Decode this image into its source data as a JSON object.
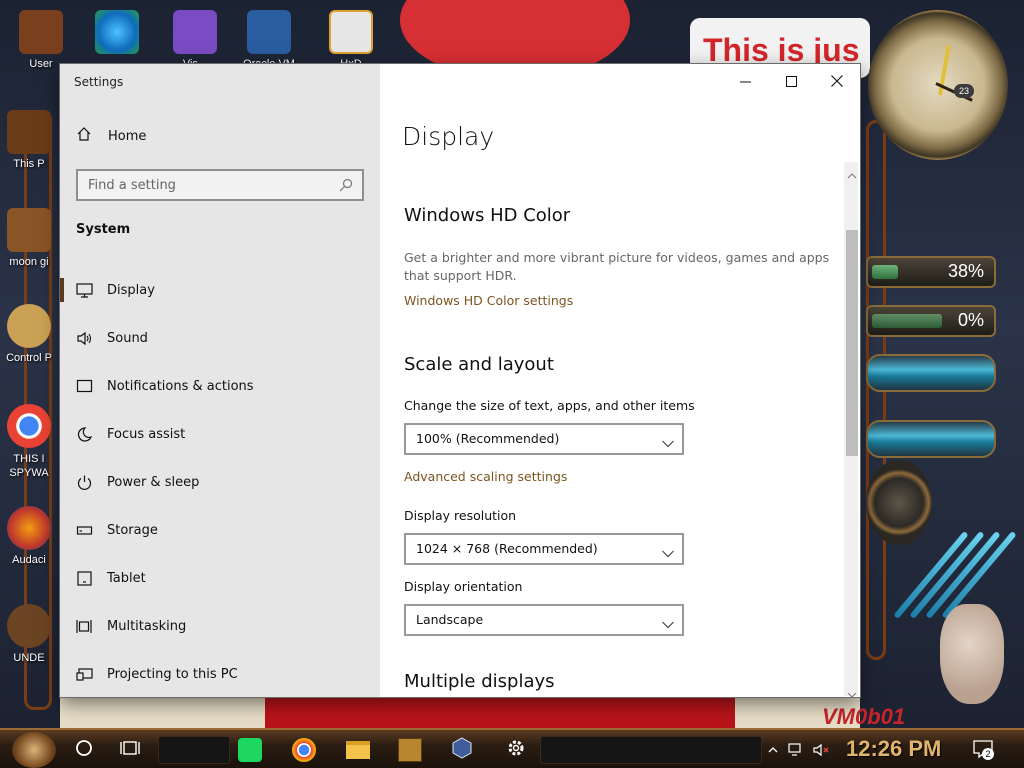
{
  "desktop": {
    "icons": [
      {
        "label": "User",
        "color": "#7a3f1c"
      },
      {
        "label": "",
        "color": "#0f84d6"
      },
      {
        "label": "Vis...",
        "color": "#7a4bc2"
      },
      {
        "label": "Oracle VM",
        "color": "#2a5d9f"
      },
      {
        "label": "HxD",
        "color": "#e6e6e6"
      },
      {
        "label": "This P",
        "color": "#6b3b18"
      },
      {
        "label": "moon gi",
        "color": "#8a5526"
      },
      {
        "label": "Control P",
        "color": "#caa155"
      },
      {
        "label": "THIS I SPYWA",
        "color": "#e8453c"
      },
      {
        "label": "Audaci",
        "color": "#e67e22"
      },
      {
        "label": "UNDE",
        "color": "#6b4423"
      }
    ],
    "wall_text": "This is jus",
    "wall_text_bottom": "VM0b01",
    "clock_badge": "23",
    "gauges": [
      {
        "pct": "38%",
        "level": 0.38
      },
      {
        "pct": "0%",
        "level": 0.0
      }
    ]
  },
  "window": {
    "app_title": "Settings",
    "controls": {
      "minimize": "minimize",
      "maximize": "maximize",
      "close": "close"
    },
    "home_label": "Home",
    "search_placeholder": "Find a setting",
    "section": "System",
    "nav": [
      {
        "label": "Display",
        "icon": "monitor-icon",
        "active": true
      },
      {
        "label": "Sound",
        "icon": "speaker-icon"
      },
      {
        "label": "Notifications & actions",
        "icon": "notifications-icon"
      },
      {
        "label": "Focus assist",
        "icon": "moon-icon"
      },
      {
        "label": "Power & sleep",
        "icon": "power-icon"
      },
      {
        "label": "Storage",
        "icon": "storage-icon"
      },
      {
        "label": "Tablet",
        "icon": "tablet-icon"
      },
      {
        "label": "Multitasking",
        "icon": "multitasking-icon"
      },
      {
        "label": "Projecting to this PC",
        "icon": "projecting-icon"
      }
    ],
    "page_title": "Display",
    "hdr": {
      "heading": "Windows HD Color",
      "description": "Get a brighter and more vibrant picture for videos, games and apps that support HDR.",
      "link": "Windows HD Color settings"
    },
    "scale": {
      "heading": "Scale and layout",
      "size_label": "Change the size of text, apps, and other items",
      "size_value": "100% (Recommended)",
      "advanced_link": "Advanced scaling settings",
      "resolution_label": "Display resolution",
      "resolution_value": "1024 × 768 (Recommended)",
      "orientation_label": "Display orientation",
      "orientation_value": "Landscape"
    },
    "multiple": {
      "heading": "Multiple displays"
    }
  },
  "taskbar": {
    "time": "12:26 PM",
    "notification_count": "2",
    "apps": [
      "cortana-icon",
      "task-view-icon",
      "spotify-icon",
      "chrome-icon",
      "file-explorer-icon",
      "game-icon",
      "virtualbox-icon",
      "settings-gear-icon"
    ]
  }
}
